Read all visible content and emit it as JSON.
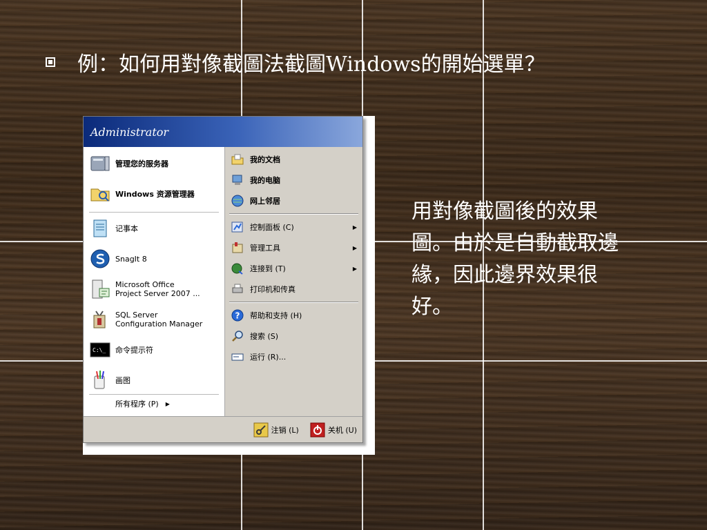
{
  "slide": {
    "title": "例：如何用對像截圖法截圖Windows的開始選單？",
    "caption": "用對像截圖後的效果圖。由於是自動截取邊緣，因此邊界效果很好。"
  },
  "start_menu": {
    "user": "Administrator",
    "left_items": [
      {
        "label": "管理您的服务器",
        "icon": "server-icon"
      },
      {
        "label": "Windows 资源管理器",
        "icon": "folder-explorer-icon"
      },
      {
        "label": "记事本",
        "icon": "notepad-icon"
      },
      {
        "label": "SnagIt 8",
        "icon": "snagit-icon"
      },
      {
        "label": "Microsoft Office\nProject Server 2007 ...",
        "icon": "project-server-icon"
      },
      {
        "label": "SQL Server\nConfiguration Manager",
        "icon": "sql-config-icon"
      },
      {
        "label": "命令提示符",
        "icon": "cmd-icon"
      },
      {
        "label": "画图",
        "icon": "paint-icon"
      }
    ],
    "all_programs": "所有程序 (P)",
    "right_items": [
      {
        "label": "我的文档",
        "icon": "my-documents-icon"
      },
      {
        "label": "我的电脑",
        "icon": "my-computer-icon"
      },
      {
        "label": "网上邻居",
        "icon": "network-places-icon"
      },
      {
        "label": "控制面板 (C)",
        "icon": "control-panel-icon"
      },
      {
        "label": "管理工具",
        "icon": "admin-tools-icon"
      },
      {
        "label": "连接到 (T)",
        "icon": "connect-to-icon"
      },
      {
        "label": "打印机和传真",
        "icon": "printer-icon"
      },
      {
        "label": "帮助和支持 (H)",
        "icon": "help-icon"
      },
      {
        "label": "搜索 (S)",
        "icon": "search-icon"
      },
      {
        "label": "运行 (R)...",
        "icon": "run-icon"
      }
    ],
    "logoff": "注销 (L)",
    "shutdown": "关机 (U)"
  }
}
